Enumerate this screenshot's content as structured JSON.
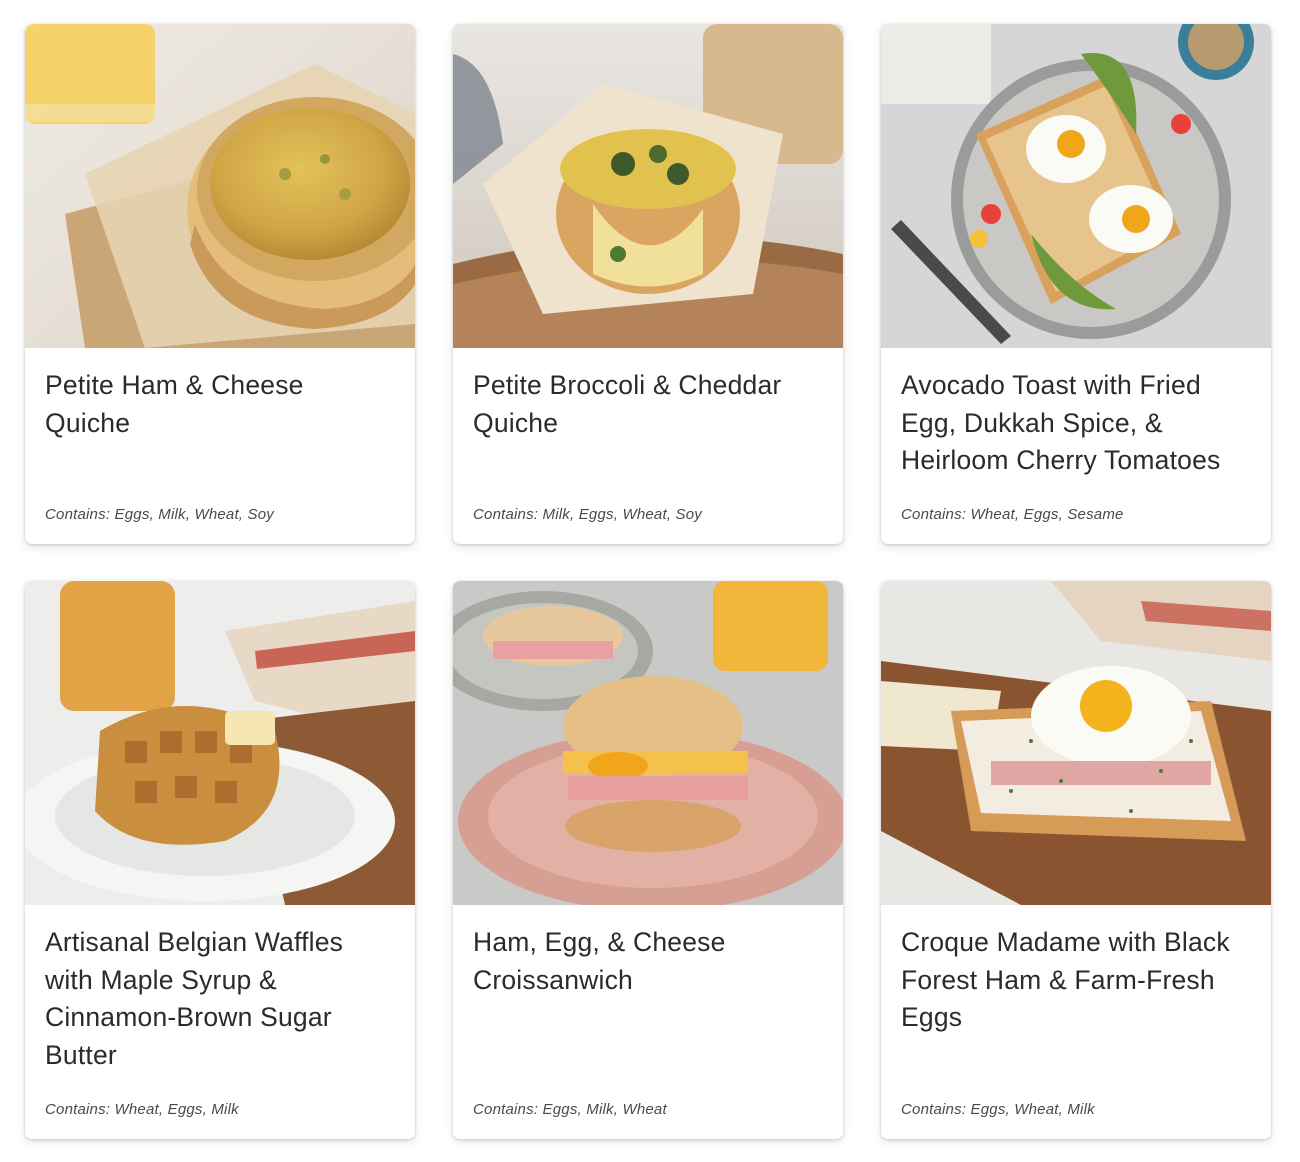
{
  "contains_label": "Contains:",
  "cards": [
    {
      "title": "Petite Ham & Cheese Quiche",
      "allergens": "Contains: Eggs, Milk, Wheat, Soy",
      "image": "quiche-ham-cheese-photo"
    },
    {
      "title": "Petite Broccoli & Cheddar Quiche",
      "allergens": "Contains: Milk, Eggs, Wheat, Soy",
      "image": "quiche-broccoli-cheddar-photo"
    },
    {
      "title": "Avocado Toast with Fried Egg, Dukkah Spice, & Heirloom Cherry Tomatoes",
      "allergens": "Contains: Wheat, Eggs, Sesame",
      "image": "avocado-toast-photo"
    },
    {
      "title": "Artisanal Belgian Waffles with Maple Syrup & Cinnamon-Brown Sugar Butter",
      "allergens": "Contains: Wheat, Eggs, Milk",
      "image": "belgian-waffles-photo"
    },
    {
      "title": "Ham, Egg, & Cheese Croissanwich",
      "allergens": "Contains: Eggs, Milk, Wheat",
      "image": "croissanwich-photo"
    },
    {
      "title": "Croque Madame with Black Forest Ham & Farm-Fresh Eggs",
      "allergens": "Contains: Eggs, Wheat, Milk",
      "image": "croque-madame-photo"
    }
  ],
  "colors": {
    "title_text": "#2b2b2b",
    "allergen_text": "#4a4a4a",
    "card_background": "#ffffff"
  }
}
